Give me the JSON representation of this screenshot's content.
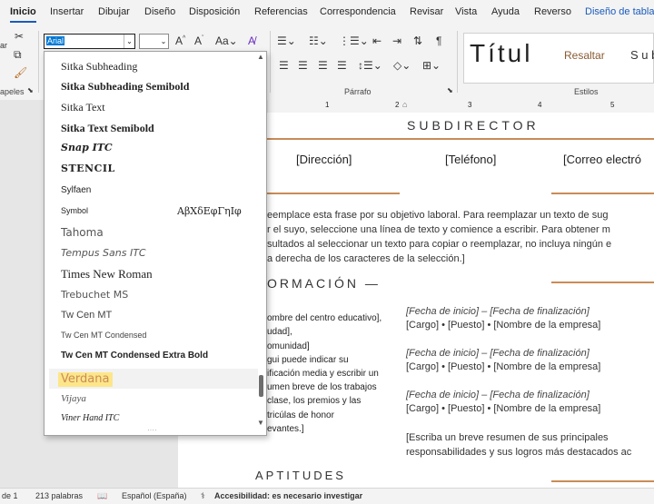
{
  "ribbon_tabs": [
    "Inicio",
    "Insertar",
    "Dibujar",
    "Diseño",
    "Disposición",
    "Referencias",
    "Correspondencia",
    "Revisar",
    "Vista",
    "Ayuda",
    "Reverso",
    "Diseño de tabla"
  ],
  "font": {
    "current": "Arial"
  },
  "ribbon": {
    "group_paragraph": "Párrafo",
    "group_styles": "Estilos",
    "group_clipboard_partial": "apeles",
    "paste_partial": "ar",
    "style_title": "Títul",
    "style_highlight": "Resaltar",
    "style_sub": "S u b"
  },
  "font_list": [
    {
      "name": "Sitka Subheading"
    },
    {
      "name": "Sitka Subheading Semibold"
    },
    {
      "name": "Sitka Text"
    },
    {
      "name": "Sitka Text Semibold"
    },
    {
      "name": "Snap ITC"
    },
    {
      "name": "STENCIL"
    },
    {
      "name": "Sylfaen"
    },
    {
      "name": "Symbol",
      "sample": "ΑβΧδΕφΓηΙφ"
    },
    {
      "name": "Tahoma"
    },
    {
      "name": "Tempus Sans ITC"
    },
    {
      "name": "Times New Roman"
    },
    {
      "name": "Trebuchet MS"
    },
    {
      "name": "Tw Cen MT"
    },
    {
      "name": "Tw Cen MT Condensed"
    },
    {
      "name": "Tw Cen MT Condensed Extra Bold"
    },
    {
      "name": "Verdana"
    },
    {
      "name": "Vijaya"
    },
    {
      "name": "Viner Hand ITC"
    }
  ],
  "document": {
    "subdirector": "SUBDIRECTOR",
    "direccion": "[Dirección]",
    "telefono": "[Teléfono]",
    "correo": "[Correo electró",
    "objective_lines": [
      "eemplace esta frase por su objetivo laboral. Para reemplazar un texto de sug",
      "r el suyo, seleccione una línea de texto y comience a escribir. Para obtener m",
      "sultados al seleccionar un texto para copiar o reemplazar, no incluya ningún e",
      "a derecha de los caracteres de la selección.]"
    ],
    "formacion": "ORMACIÓN —",
    "left_col_lines": [
      "ombre del centro educativo],",
      "udad],",
      "omunidad]",
      "gui puede indicar su",
      "ificación media y escribir un",
      "umen breve de los trabajos",
      " clase, los premios y las",
      "tricúlas de honor",
      "evantes.]"
    ],
    "entries": [
      {
        "dates": "[Fecha de inicio] – [Fecha de finalización]",
        "role": "[Cargo] • [Puesto] • [Nombre de la empresa]"
      },
      {
        "dates": "[Fecha de inicio] – [Fecha de finalización]",
        "role": "[Cargo] • [Puesto] • [Nombre de la empresa]"
      },
      {
        "dates": "[Fecha de inicio] – [Fecha de finalización]",
        "role": "[Cargo] • [Puesto] • [Nombre de la empresa]"
      }
    ],
    "summary_lines": [
      "[Escriba un breve resumen de sus principales",
      "responsabilidades y sus logros más destacados ac"
    ],
    "aptitudes": "APTITUDES",
    "ruler_numbers": [
      "1",
      "2",
      "3",
      "4",
      "5"
    ]
  },
  "status": {
    "page": "de 1",
    "words": "213 palabras",
    "language": "Español (España)",
    "accessibility": "Accesibilidad: es necesario investigar"
  },
  "colors": {
    "accent": "#c98c57",
    "selection": "#fde68a",
    "tab_blue": "#185abd"
  }
}
